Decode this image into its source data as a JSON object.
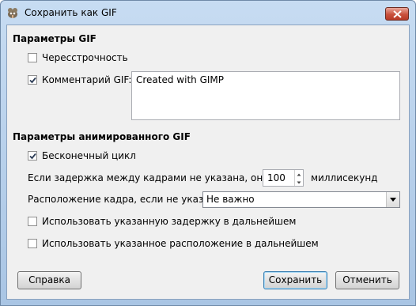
{
  "window": {
    "title": "Сохранить как GIF",
    "icon": "gimp-icon",
    "close_icon": "close-icon"
  },
  "gif_params": {
    "heading": "Параметры GIF",
    "interlace": {
      "label": "Чересстрочность",
      "checked": false
    },
    "comment": {
      "label": "Комментарий GIF:",
      "checked": true,
      "value": "Created with GIMP"
    }
  },
  "anim_params": {
    "heading": "Параметры анимированного GIF",
    "loop": {
      "label": "Бесконечный цикл",
      "checked": true
    },
    "delay": {
      "label": "Если задержка между кадрами не указана, она равна:",
      "value": "100",
      "unit": "миллисекунд"
    },
    "disposal": {
      "label": "Расположение кадра, если не указано:",
      "selected": "Не важно"
    },
    "use_delay": {
      "label": "Использовать указанную задержку в дальнейшем",
      "checked": false
    },
    "use_disposal": {
      "label": "Использовать указанное расположение в дальнейшем",
      "checked": false
    }
  },
  "buttons": {
    "help": "Справка",
    "save": "Сохранить",
    "cancel": "Отменить"
  }
}
